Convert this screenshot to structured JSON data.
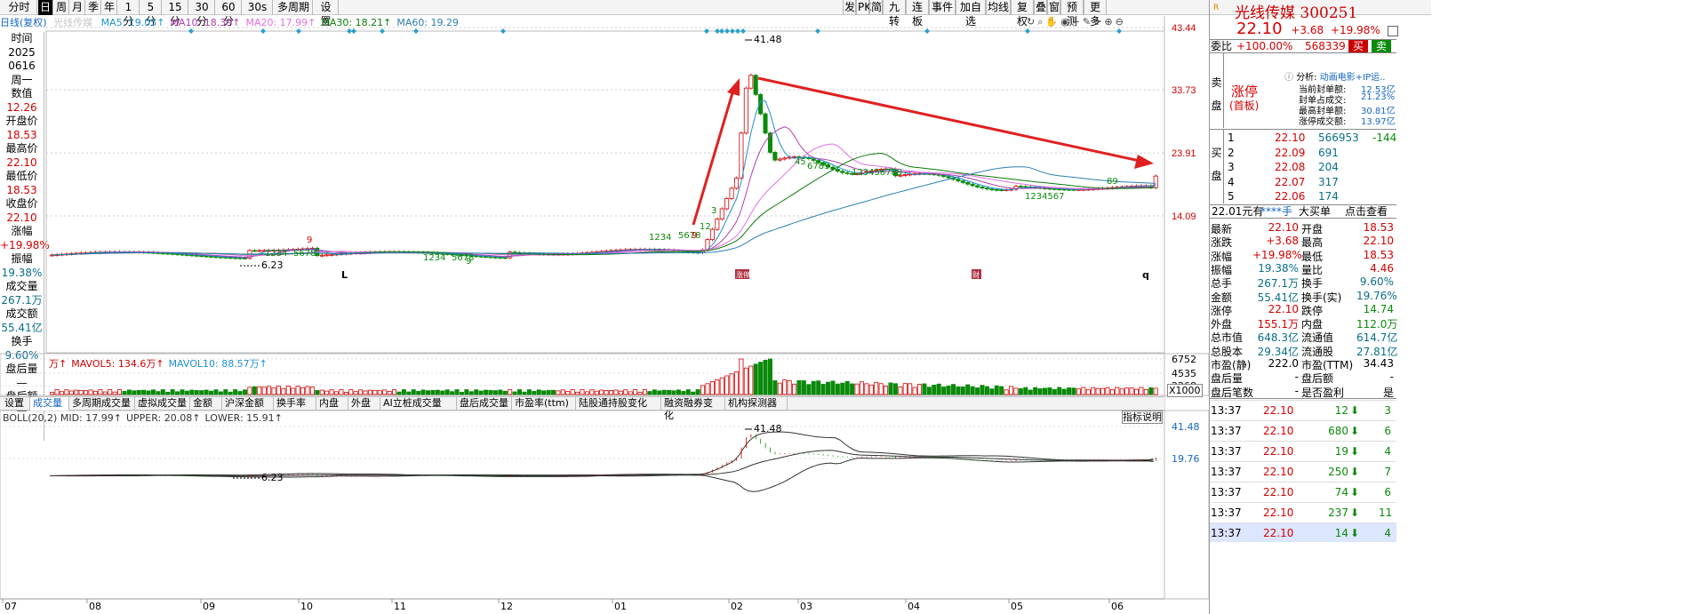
{
  "toolbar_left": [
    {
      "label": "分时",
      "x": 2,
      "w": 40
    },
    {
      "label": "日",
      "x": 43,
      "w": 17,
      "active": true
    },
    {
      "label": "周",
      "x": 61,
      "w": 17
    },
    {
      "label": "月",
      "x": 79,
      "w": 17
    },
    {
      "label": "季",
      "x": 97,
      "w": 17
    },
    {
      "label": "年",
      "x": 115,
      "w": 17
    },
    {
      "label": "1分",
      "x": 133,
      "w": 24
    },
    {
      "label": "5分",
      "x": 158,
      "w": 24
    },
    {
      "label": "15分",
      "x": 183,
      "w": 29
    },
    {
      "label": "30分",
      "x": 213,
      "w": 29
    },
    {
      "label": "60分",
      "x": 243,
      "w": 29
    },
    {
      "label": "30s",
      "x": 273,
      "w": 34
    },
    {
      "label": "多周期",
      "x": 309,
      "w": 43
    },
    {
      "label": "设置",
      "x": 353,
      "w": 28
    }
  ],
  "toolbar_right": [
    "发",
    "PK",
    "简",
    "九转",
    "连板",
    "事件",
    "加自选",
    "均线",
    "复权",
    "叠",
    "窗",
    "预测",
    "更多"
  ],
  "window_controls": [
    "⊕",
    "⊖"
  ],
  "ma_legend": {
    "prefix": "日线(复权)",
    "stock_name": "光线传媒",
    "items": [
      {
        "text": "MA5: 19.05↑",
        "color": "#1f8fd0"
      },
      {
        "text": "MA10: 18.39↑",
        "color": "#b040b0"
      },
      {
        "text": "MA20: 17.99↑",
        "color": "#e070e0"
      },
      {
        "text": "MA30: 18.21↑",
        "color": "#0b7b0b"
      },
      {
        "text": "MA60: 19.29",
        "color": "#2b7fb0"
      }
    ]
  },
  "info": {
    "time_label": "时间",
    "date_year": "2025",
    "date_md": "0616",
    "weekday": "周一",
    "value_label": "数值",
    "value": "12.26",
    "open_label": "开盘价",
    "open": "18.53",
    "high_label": "最高价",
    "high": "22.10",
    "low_label": "最低价",
    "low": "18.53",
    "close_label": "收盘价",
    "close": "22.10",
    "chg_label": "涨幅",
    "chg": "+19.98%",
    "amp_label": "振幅",
    "amp": "19.38%",
    "vol_label": "成交量",
    "vol": "267.1万",
    "amt_label": "成交额",
    "amt": "55.41亿",
    "turn_label": "换手",
    "turn": "9.60%",
    "after_vol_label": "盘后量",
    "after_vol": "—",
    "after_amt_label": "盘后额",
    "after_amt": "—"
  },
  "chart_data": [
    {
      "type": "candlestick",
      "title": "日线(复权)",
      "y_ticks": [
        "43.44",
        "33.73",
        "23.91",
        "14.09"
      ],
      "annotations": [
        "41.48",
        "6.23",
        "L",
        "q",
        "涨停",
        "财"
      ],
      "td_seq_labels": [
        "1234",
        "5678",
        "9",
        "1234",
        "5678",
        "9",
        "1234",
        "5678",
        "9",
        "12",
        "3",
        "45",
        "6789",
        "123456789",
        "1234567",
        "89"
      ],
      "latest": {
        "open": 18.53,
        "high": 22.1,
        "low": 18.53,
        "close": 22.1
      }
    },
    {
      "type": "bar",
      "title": "VOL",
      "legend": [
        {
          "text": "万↑",
          "color": "#c00"
        },
        {
          "text": "MAVOL5: 134.6万↑",
          "color": "#c00"
        },
        {
          "text": "MAVOL10: 88.57万↑",
          "color": "#1f8fd0"
        }
      ],
      "y_ticks": [
        "6752",
        "4535",
        "2268"
      ],
      "unit": "X1000"
    },
    {
      "type": "line",
      "title": "BOLL(20,2)",
      "legend": [
        {
          "text": "BOLL(20,2) MID: 17.99↑",
          "color": "#333"
        },
        {
          "text": "UPPER: 20.08↑",
          "color": "#333"
        },
        {
          "text": "LOWER: 15.91↑",
          "color": "#333"
        }
      ],
      "y_ticks": [
        "41.48",
        "19.76"
      ],
      "annotations": [
        "41.48",
        "6.23"
      ],
      "x_ticks": [
        "07",
        "08",
        "09",
        "10",
        "11",
        "12",
        "01",
        "02",
        "03",
        "04",
        "05",
        "06"
      ]
    }
  ],
  "tabs": [
    "设置",
    "成交量",
    "多周期成交量",
    "虚拟成交量",
    "金额",
    "沪深金额",
    "换手率",
    "内盘",
    "外盘",
    "AI立桩成交量",
    "盘后成交量",
    "市盈率(ttm)",
    "陆股通持股变化",
    "融资融券变化",
    "机构探测器"
  ],
  "indicator_button": "指标说明",
  "quote": {
    "stock_name": "光线传媒",
    "code": "300251",
    "price": "22.10",
    "change": "+3.68",
    "change_pct": "+19.98%",
    "webi_label": "委比",
    "webi": "+100.00%",
    "webi_diff": "568339",
    "buy_label": "买",
    "sell_label": "卖",
    "sell_side_label": "卖盘",
    "buy_side_label": "买盘",
    "limit_up_label": "涨停",
    "limit_up_sub": "(首板)",
    "analysis_label": "分析:",
    "analysis_tags": "动画电影+IP运..",
    "seal_items": [
      {
        "label": "当前封单额:",
        "value": "12.53亿"
      },
      {
        "label": "封单占成交:",
        "value": "21.23%"
      },
      {
        "label": "最高封单额:",
        "value": "30.81亿"
      },
      {
        "label": "涨停成交额:",
        "value": "13.97亿"
      }
    ],
    "bids": [
      {
        "lv": "1",
        "price": "22.10",
        "vol": "566953",
        "chg": "-144"
      },
      {
        "lv": "2",
        "price": "22.09",
        "vol": "691",
        "chg": ""
      },
      {
        "lv": "3",
        "price": "22.08",
        "vol": "204",
        "chg": ""
      },
      {
        "lv": "4",
        "price": "22.07",
        "vol": "317",
        "chg": ""
      },
      {
        "lv": "5",
        "price": "22.06",
        "vol": "174",
        "chg": ""
      }
    ],
    "bar_text": [
      "22.01元有",
      "****手",
      "大买单",
      "点击查看"
    ],
    "stats": [
      {
        "l": "最新",
        "lv": "22.10",
        "r": "开盘",
        "rv": "18.53"
      },
      {
        "l": "涨跌",
        "lv": "+3.68",
        "r": "最高",
        "rv": "22.10"
      },
      {
        "l": "涨幅",
        "lv": "+19.98%",
        "r": "最低",
        "rv": "18.53"
      },
      {
        "l": "振幅",
        "lv": "19.38%",
        "r": "量比",
        "rv": "4.46"
      },
      {
        "l": "总手",
        "lv": "267.1万",
        "r": "换手",
        "rv": "9.60%"
      },
      {
        "l": "金额",
        "lv": "55.41亿",
        "r": "换手(实)",
        "rv": "19.76%"
      },
      {
        "l": "涨停",
        "lv": "22.10",
        "r": "跌停",
        "rv": "14.74"
      },
      {
        "l": "外盘",
        "lv": "155.1万",
        "r": "内盘",
        "rv": "112.0万"
      },
      {
        "l": "总市值",
        "lv": "648.3亿",
        "r": "流通值",
        "rv": "614.7亿"
      },
      {
        "l": "总股本",
        "lv": "29.34亿",
        "r": "流通股",
        "rv": "27.81亿"
      },
      {
        "l": "市盈(静)",
        "lv": "222.0",
        "r": "市盈(TTM)",
        "rv": "34.43"
      },
      {
        "l": "盘后量",
        "lv": "-",
        "r": "盘后额",
        "rv": "-"
      },
      {
        "l": "盘后笔数",
        "lv": "-",
        "r": "是否盈利",
        "rv": "是"
      }
    ],
    "trades": [
      {
        "t": "13:37",
        "p": "22.10",
        "v": "12",
        "n": "3"
      },
      {
        "t": "13:37",
        "p": "22.10",
        "v": "680",
        "n": "6"
      },
      {
        "t": "13:37",
        "p": "22.10",
        "v": "19",
        "n": "4"
      },
      {
        "t": "13:37",
        "p": "22.10",
        "v": "250",
        "n": "7"
      },
      {
        "t": "13:37",
        "p": "22.10",
        "v": "74",
        "n": "6"
      },
      {
        "t": "13:37",
        "p": "22.10",
        "v": "237",
        "n": "11"
      },
      {
        "t": "13:37",
        "p": "22.10",
        "v": "14",
        "n": "4"
      }
    ]
  }
}
